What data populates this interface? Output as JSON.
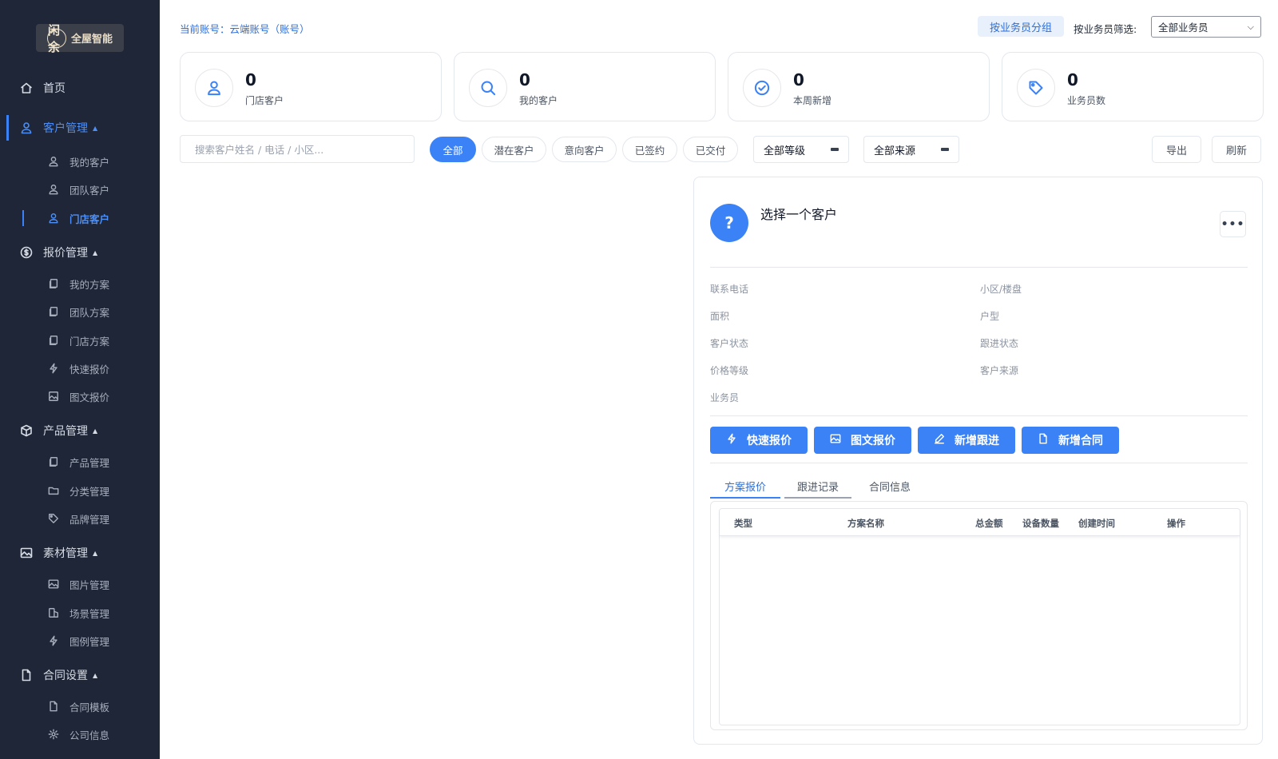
{
  "brand": {
    "logo_mark": "闲余",
    "logo_text": "全屋智能"
  },
  "sidebar": {
    "home": "首页",
    "customer_mgmt": "客户管理",
    "my_customers": "我的客户",
    "team_customers": "团队客户",
    "store_customers": "门店客户",
    "quote_mgmt": "报价管理",
    "my_plans": "我的方案",
    "team_plans": "团队方案",
    "store_plans": "门店方案",
    "quick_quote": "快速报价",
    "graphic_quote": "图文报价",
    "product_mgmt": "产品管理",
    "product_mgmt_sub": "产品管理",
    "category_mgmt": "分类管理",
    "brand_mgmt": "品牌管理",
    "material_mgmt": "素材管理",
    "image_mgmt": "图片管理",
    "scene_mgmt": "场景管理",
    "legend_mgmt": "图例管理",
    "contract_settings": "合同设置",
    "contract_template": "合同模板",
    "company_info": "公司信息"
  },
  "header": {
    "account": "当前账号：云端账号（账号）",
    "group_button": "按业务员分组",
    "filter_label": "按业务员筛选:",
    "filter_value": "全部业务员"
  },
  "stats": [
    {
      "value": "0",
      "label": "门店客户",
      "icon": "user-icon"
    },
    {
      "value": "0",
      "label": "我的客户",
      "icon": "search-icon"
    },
    {
      "value": "0",
      "label": "本周新增",
      "icon": "check-circle-icon"
    },
    {
      "value": "0",
      "label": "业务员数",
      "icon": "tag-icon"
    }
  ],
  "filters": {
    "search_placeholder": "搜索客户姓名 / 电话 / 小区...",
    "chips": [
      "全部",
      "潜在客户",
      "意向客户",
      "已签约",
      "已交付"
    ],
    "active_chip": "全部",
    "level": "全部等级",
    "source": "全部来源",
    "export": "导出",
    "refresh": "刷新"
  },
  "detail": {
    "title": "选择一个客户",
    "avatar_glyph": "?",
    "more": "•••",
    "fields": {
      "phone": "联系电话",
      "community": "小区/楼盘",
      "area": "面积",
      "layout": "户型",
      "status": "客户状态",
      "follow_status": "跟进状态",
      "price_level": "价格等级",
      "source": "客户来源",
      "salesperson": "业务员"
    },
    "actions": [
      "快速报价",
      "图文报价",
      "新增跟进",
      "新增合同"
    ],
    "tabs": [
      "方案报价",
      "跟进记录",
      "合同信息"
    ],
    "active_tab": "方案报价",
    "table_headers": [
      "类型",
      "方案名称",
      "总金额",
      "设备数量",
      "创建时间",
      "操作"
    ]
  },
  "colors": {
    "sidebar_bg": "#1e2637",
    "primary": "#3b82f6",
    "accent_text": "#2f6fd6"
  }
}
